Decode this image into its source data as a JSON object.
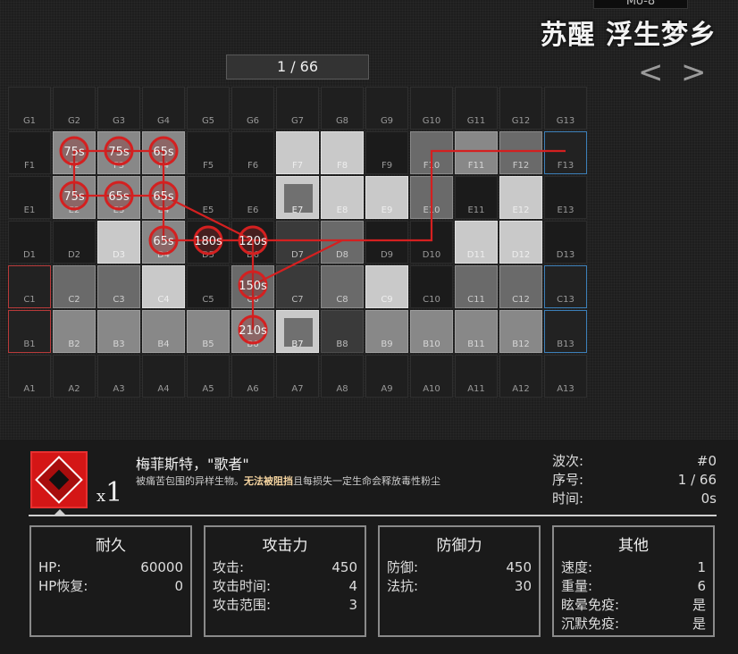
{
  "header": {
    "stage_code": "Mo-8",
    "stage_title": "苏醒 浮生梦乡",
    "prev_label": "<",
    "next_label": ">",
    "page_counter": "1 / 66"
  },
  "map": {
    "rows": [
      {
        "name": "G",
        "tiles": [
          "r",
          "r",
          "r",
          "r",
          "r",
          "r",
          "r",
          "r",
          "r",
          "r",
          "r",
          "r",
          "r"
        ]
      },
      {
        "name": "F",
        "tiles": [
          "o",
          "g",
          "g",
          "g",
          "o",
          "o",
          "w",
          "w",
          "o",
          "d",
          "g",
          "d",
          "b"
        ]
      },
      {
        "name": "E",
        "tiles": [
          "o",
          "g",
          "g",
          "g",
          "o",
          "o",
          "x",
          "w",
          "w",
          "d",
          "o",
          "w",
          "o"
        ]
      },
      {
        "name": "D",
        "tiles": [
          "o",
          "o",
          "w",
          "g",
          "o",
          "o",
          "h",
          "d",
          "o",
          "o",
          "w",
          "w",
          "o"
        ]
      },
      {
        "name": "C",
        "tiles": [
          "s",
          "d",
          "d",
          "w",
          "o",
          "d",
          "h",
          "d",
          "w",
          "o",
          "d",
          "d",
          "b"
        ]
      },
      {
        "name": "B",
        "tiles": [
          "s",
          "g",
          "g",
          "g",
          "g",
          "g",
          "x",
          "h",
          "g",
          "g",
          "g",
          "g",
          "b"
        ]
      },
      {
        "name": "A",
        "tiles": [
          "r",
          "r",
          "r",
          "r",
          "r",
          "r",
          "r",
          "r",
          "r",
          "r",
          "r",
          "r",
          "r"
        ]
      }
    ],
    "waits": [
      {
        "label": "75s",
        "row": "F",
        "col": 2
      },
      {
        "label": "75s",
        "row": "F",
        "col": 3
      },
      {
        "label": "65s",
        "row": "F",
        "col": 4
      },
      {
        "label": "75s",
        "row": "E",
        "col": 2
      },
      {
        "label": "65s",
        "row": "E",
        "col": 3
      },
      {
        "label": "65s",
        "row": "E",
        "col": 4
      },
      {
        "label": "65s",
        "row": "D",
        "col": 4
      },
      {
        "label": "180s",
        "row": "D",
        "col": 5
      },
      {
        "label": "120s",
        "row": "D",
        "col": 6
      },
      {
        "label": "150s",
        "row": "C",
        "col": 6
      },
      {
        "label": "210s",
        "row": "B",
        "col": 6
      }
    ],
    "path": [
      [
        "F",
        13
      ],
      [
        "F",
        10
      ],
      [
        "D",
        10
      ],
      [
        "D",
        4
      ],
      [
        "F",
        4
      ],
      [
        "F",
        2
      ],
      [
        "E",
        2
      ],
      [
        "E",
        4
      ],
      [
        "D",
        6
      ],
      [
        "B",
        6
      ]
    ],
    "branch": [
      [
        "C",
        6
      ],
      [
        "D",
        8
      ]
    ],
    "colors": {
      "route": "#d42020",
      "spawn": "#3c7fb8",
      "goal": "#b83a3a"
    }
  },
  "enemy": {
    "icon": "mephisto-enemy-icon",
    "count_prefix": "x",
    "count": "1",
    "name": "梅菲斯特，\"歌者\"",
    "desc_pre": "被痛苦包围的异样生物。",
    "desc_highlight": "无法被阻挡",
    "desc_post": "且每损失一定生命会释放毒性粉尘"
  },
  "meta": {
    "wave_label": "波次:",
    "wave_value": "#0",
    "index_label": "序号:",
    "index_value": "1 / 66",
    "time_label": "时间:",
    "time_value": "0s"
  },
  "stats": {
    "durability": {
      "title": "耐久",
      "rows": [
        {
          "label": "HP:",
          "value": "60000"
        },
        {
          "label": "HP恢复:",
          "value": "0"
        }
      ]
    },
    "attack": {
      "title": "攻击力",
      "rows": [
        {
          "label": "攻击:",
          "value": "450"
        },
        {
          "label": "攻击时间:",
          "value": "4"
        },
        {
          "label": "攻击范围:",
          "value": "3"
        }
      ]
    },
    "defense": {
      "title": "防御力",
      "rows": [
        {
          "label": "防御:",
          "value": "450"
        },
        {
          "label": "法抗:",
          "value": "30"
        }
      ]
    },
    "other": {
      "title": "其他",
      "rows": [
        {
          "label": "速度:",
          "value": "1"
        },
        {
          "label": "重量:",
          "value": "6"
        },
        {
          "label": "眩晕免疫:",
          "value": "是"
        },
        {
          "label": "沉默免疫:",
          "value": "是"
        }
      ]
    }
  }
}
